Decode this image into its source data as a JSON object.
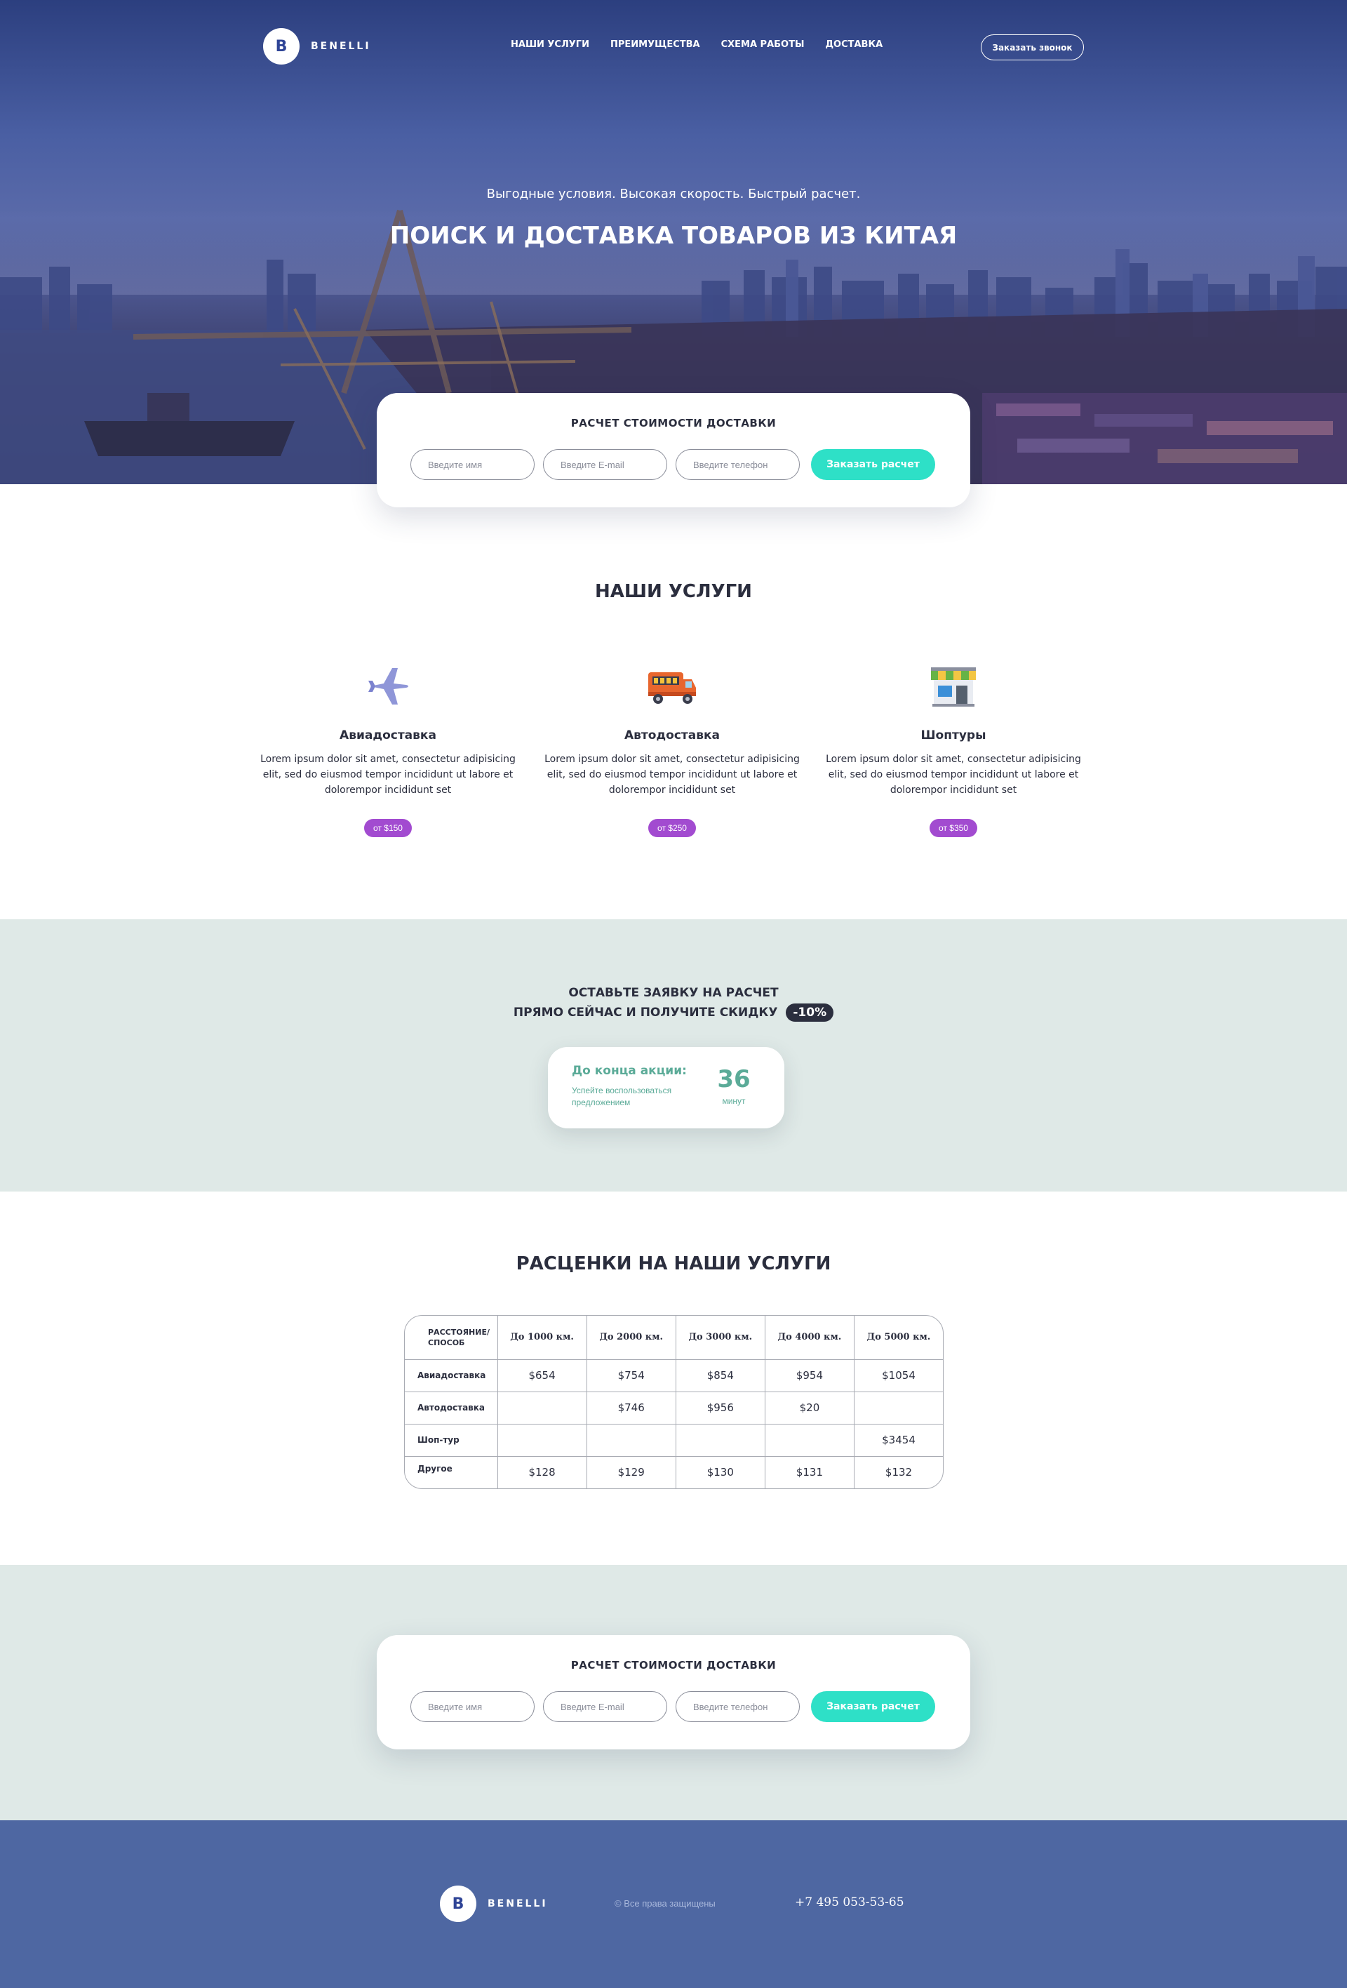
{
  "brand": {
    "logo_letter": "B",
    "name": "BENELLI"
  },
  "nav": {
    "items": [
      "НАШИ УСЛУГИ",
      "ПРЕИМУЩЕСТВА",
      "СХЕМА РАБОТЫ",
      "ДОСТАВКА"
    ],
    "call_button": "Заказать звонок"
  },
  "hero": {
    "subtitle": "Выгодные условия. Высокая скорость. Быстрый расчет.",
    "title": "ПОИСК И ДОСТАВКА ТОВАРОВ ИЗ КИТАЯ"
  },
  "calc_form": {
    "title": "РАСЧЕТ СТОИМОСТИ ДОСТАВКИ",
    "name_placeholder": "Введите имя",
    "email_placeholder": "Введите E-mail",
    "phone_placeholder": "Введите телефон",
    "submit": "Заказать расчет"
  },
  "services": {
    "title": "НАШИ УСЛУГИ",
    "items": [
      {
        "icon": "airplane-icon",
        "name": "Авиадоставка",
        "desc": "Lorem ipsum dolor sit amet, consectetur adipisicing elit, sed do eiusmod tempor incididunt ut labore et dolorempor incididunt set",
        "price": "от $150"
      },
      {
        "icon": "truck-icon",
        "name": "Автодоставка",
        "desc": "Lorem ipsum dolor sit amet, consectetur adipisicing elit, sed do eiusmod tempor incididunt ut labore et dolorempor incididunt set",
        "price": "от $250"
      },
      {
        "icon": "shop-icon",
        "name": "Шоптуры",
        "desc": "Lorem ipsum dolor sit amet, consectetur adipisicing elit, sed do eiusmod tempor incididunt ut labore et dolorempor incididunt set",
        "price": "от $350"
      }
    ]
  },
  "promo": {
    "line1": "ОСТАВЬТЕ ЗАЯВКУ НА РАСЧЕТ",
    "line2": "ПРЯМО СЕЙЧАС И ПОЛУЧИТЕ СКИДКУ",
    "discount": "-10%",
    "timer_title": "До конца акции:",
    "timer_subtitle": "Успейте воспользоваться предложением",
    "timer_value": "36",
    "timer_unit": "минут"
  },
  "pricing": {
    "title": "РАСЦЕНКИ НА НАШИ УСЛУГИ",
    "corner_header": "РАССТОЯНИЕ/ СПОСОБ",
    "columns": [
      "До 1000 км.",
      "До 2000 км.",
      "До 3000 км.",
      "До 4000 км.",
      "До 5000 км."
    ],
    "rows": [
      {
        "label": "Авиадоставка",
        "values": [
          "$654",
          "$754",
          "$854",
          "$954",
          "$1054"
        ]
      },
      {
        "label": "Автодоставка",
        "values": [
          "",
          "$746",
          "$956",
          "$20",
          ""
        ]
      },
      {
        "label": "Шоп-тур",
        "values": [
          "",
          "",
          "",
          "",
          "$3454"
        ]
      },
      {
        "label": "Другое",
        "values": [
          "$128",
          "$129",
          "$130",
          "$131",
          "$132"
        ]
      }
    ]
  },
  "footer": {
    "copyright": "© Все права защищены",
    "phone": "+7 495 053-53-65"
  },
  "colors": {
    "hero_blue": "#2f4496",
    "accent_teal": "#2ee0c7",
    "price_purple": "#a24bd0",
    "promo_bg": "#dfe9e7",
    "timer_green": "#5bab98",
    "footer_blue": "#4e67a2",
    "dark_text": "#2b2e3e"
  }
}
